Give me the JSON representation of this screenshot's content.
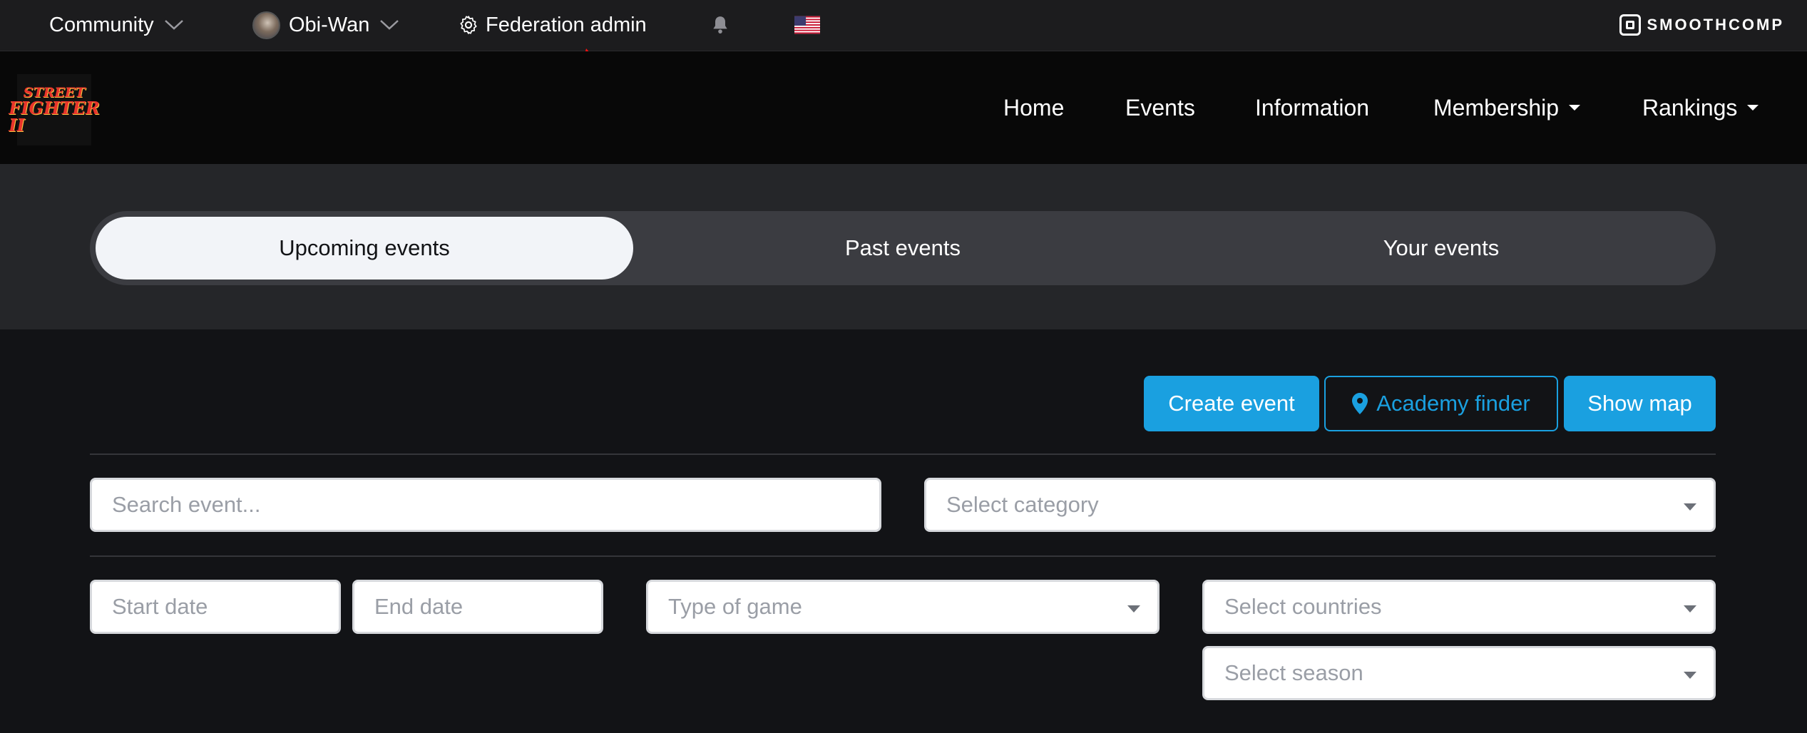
{
  "topbar": {
    "community_label": "Community",
    "user_name": "Obi-Wan",
    "admin_label": "Federation admin",
    "brand": "SMOOTHCOMP"
  },
  "nav": {
    "logo_line1": "STREET",
    "logo_line2": "FIGHTER II",
    "items": [
      {
        "label": "Home"
      },
      {
        "label": "Events"
      },
      {
        "label": "Information"
      },
      {
        "label": "Membership"
      },
      {
        "label": "Rankings"
      }
    ]
  },
  "tabs": [
    {
      "label": "Upcoming events",
      "active": true
    },
    {
      "label": "Past events",
      "active": false
    },
    {
      "label": "Your events",
      "active": false
    }
  ],
  "actions": {
    "create_event": "Create event",
    "academy_finder": "Academy finder",
    "show_map": "Show map"
  },
  "filters": {
    "search_placeholder": "Search event...",
    "category_placeholder": "Select category",
    "start_date_placeholder": "Start date",
    "end_date_placeholder": "End date",
    "game_type_placeholder": "Type of game",
    "countries_placeholder": "Select countries",
    "season_placeholder": "Select season"
  },
  "colors": {
    "accent": "#1aa0e0",
    "topbar_bg": "#1c1c1e",
    "navbar_bg": "#080808",
    "page_bg": "#121316"
  },
  "icons": [
    "chevron-down-icon",
    "avatar",
    "gear-icon",
    "bell-icon",
    "us-flag-icon",
    "smoothcomp-logo-icon",
    "map-pin-icon",
    "caret-down-icon"
  ]
}
